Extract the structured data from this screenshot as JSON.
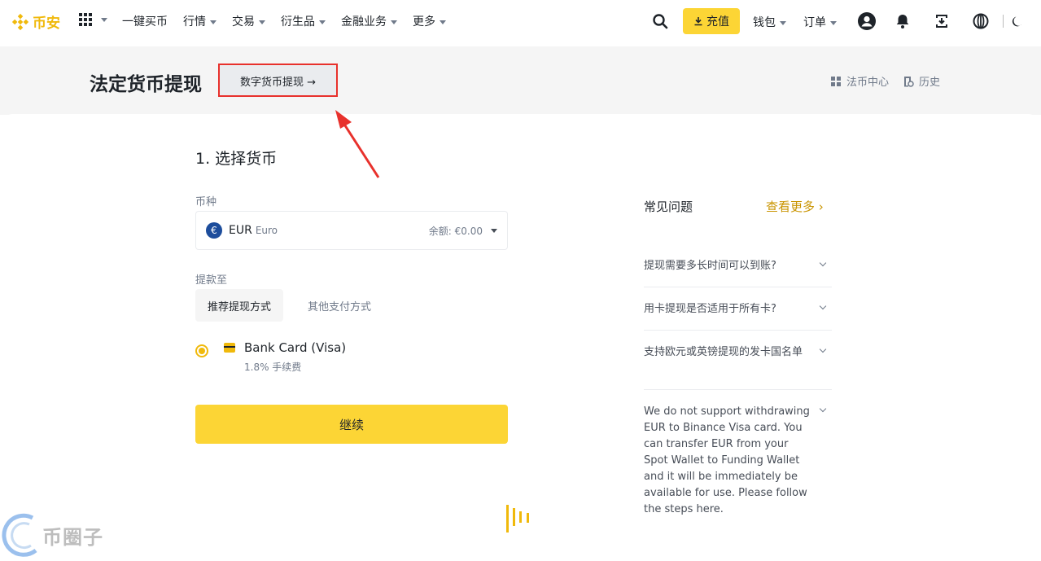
{
  "nav": {
    "logo_text": "币安",
    "menu": [
      "一键买币",
      "行情",
      "交易",
      "衍生品",
      "金融业务",
      "更多"
    ],
    "deposit_label": "充值",
    "wallet_label": "钱包",
    "orders_label": "订单",
    "accent_color": "#fcd535",
    "brand_color": "#f0b90b"
  },
  "header": {
    "title": "法定货币提现",
    "crypto_withdraw_label": "数字货币提现 →",
    "fiat_center_label": "法币中心",
    "history_label": "历史"
  },
  "form": {
    "step_title": "1. 选择货币",
    "currency_label": "币种",
    "currency_symbol": "€",
    "currency_code": "EUR",
    "currency_name": "Euro",
    "balance": "余额: €0.00",
    "withdraw_to_label": "提款至",
    "tabs": [
      "推荐提现方式",
      "其他支付方式"
    ],
    "method_name": "Bank Card (Visa)",
    "method_fee": "1.8% 手续费",
    "continue_label": "继续"
  },
  "faq": {
    "title": "常见问题",
    "more_label": "查看更多 ›",
    "items": [
      "提现需要多长时间可以到账?",
      "用卡提现是否适用于所有卡?",
      "支持欧元或英镑提现的发卡国名单",
      "We do not support withdrawing EUR to Binance Visa card. You can transfer EUR from your Spot Wallet to Funding Wallet and it will be immediately be available for use. Please follow the steps here."
    ]
  },
  "watermark": "币圈子"
}
